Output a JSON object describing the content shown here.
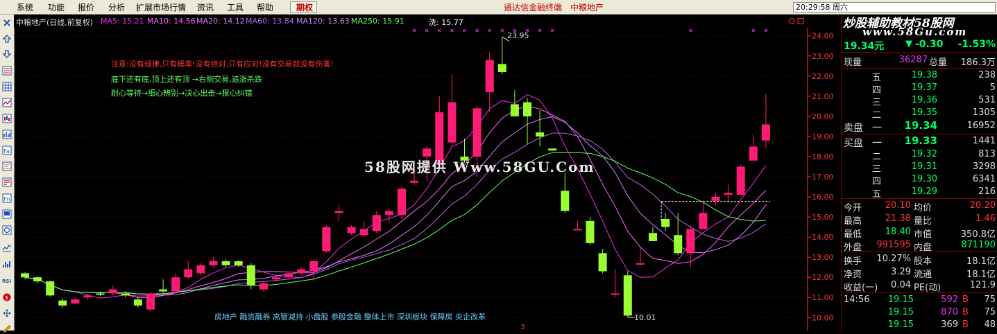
{
  "menu": {
    "items": [
      "系统",
      "功能",
      "报价",
      "分析",
      "扩展市场行情",
      "资讯",
      "工具",
      "帮助"
    ],
    "qiquan": "期权",
    "terminal": "通达信金融终端",
    "stock": "中粮地产",
    "clock": "20:29:58 周六"
  },
  "chart_header": {
    "title": "中粮地产(日线,前复权)",
    "ma5": "MA5: 15.21",
    "ma10": "MA10: 14.56",
    "ma20": "MA20: 14.12",
    "ma60": "MA60: 13.84",
    "ma120": "MA120: 13.63",
    "ma250": "MA250: 15.91",
    "xi": "洗: 15.77"
  },
  "notes": {
    "line1": "注意:没有规律,只有概率!没有绝对,只有应对!没有交易就没有伤害!",
    "line2": "底下还有底,顶上还有顶 →右侧交易,追涨杀跌",
    "line3": "耐心等待→细心辨别→决心出击→狠心纠错",
    "tags": "房地产 融资融券 高管减持 小盘股 参股金融 整体上市 深圳板块 保障房 央企改革",
    "marker": "3"
  },
  "watermark": {
    "center": "58股网提供  Www.58GU.Com",
    "top1": "炒股辅助教材58股网",
    "top2": "www.58Gu.com"
  },
  "chart_data": {
    "type": "candlestick",
    "y_ticks": [
      "24.00",
      "23.00",
      "22.00",
      "21.00",
      "20.00",
      "19.00",
      "18.00",
      "17.00",
      "16.00",
      "15.00",
      "14.00",
      "13.00",
      "12.00",
      "11.00",
      "10.00"
    ],
    "ylim": [
      9.7,
      24.3
    ],
    "high_label": "23.95",
    "low_label": "10.01",
    "colors": {
      "up": "#ff1a75",
      "down": "#99ff33",
      "ma": [
        "#e633e6",
        "#ff66ff",
        "#d580ff",
        "#b366e6",
        "#66ff66"
      ],
      "grid": "#800000",
      "axis": "#ff3333"
    },
    "candles": [
      [
        12.2,
        12.0,
        12.25,
        11.9
      ],
      [
        12.0,
        11.8,
        12.05,
        11.7
      ],
      [
        11.8,
        11.1,
        11.85,
        11.05
      ],
      [
        10.85,
        10.6,
        10.95,
        10.5
      ],
      [
        10.7,
        10.9,
        11.0,
        10.65
      ],
      [
        11.0,
        11.1,
        11.2,
        10.9
      ],
      [
        11.2,
        11.15,
        11.3,
        11.05
      ],
      [
        11.2,
        11.4,
        11.6,
        11.1
      ],
      [
        11.2,
        11.1,
        11.3,
        11.0
      ],
      [
        10.9,
        10.6,
        11.0,
        10.5
      ],
      [
        10.4,
        11.2,
        11.3,
        10.3
      ],
      [
        11.4,
        11.3,
        11.9,
        11.2
      ],
      [
        11.3,
        12.0,
        12.2,
        11.2
      ],
      [
        12.0,
        12.4,
        12.8,
        11.9
      ],
      [
        12.2,
        12.6,
        12.7,
        12.1
      ],
      [
        12.6,
        12.8,
        13.0,
        12.5
      ],
      [
        12.8,
        12.6,
        12.9,
        12.5
      ],
      [
        12.8,
        12.6,
        12.85,
        12.5
      ],
      [
        12.6,
        11.6,
        12.7,
        11.4
      ],
      [
        11.4,
        11.7,
        11.8,
        11.3
      ],
      [
        11.9,
        12.0,
        12.05,
        11.8
      ],
      [
        12.0,
        12.2,
        12.3,
        11.9
      ],
      [
        12.2,
        12.4,
        12.5,
        12.1
      ],
      [
        12.3,
        12.8,
        12.9,
        11.8
      ],
      [
        13.3,
        14.5,
        14.6,
        13.2
      ],
      [
        15.2,
        15.3,
        15.6,
        14.8
      ],
      [
        14.2,
        14.5,
        14.6,
        14.1
      ],
      [
        14.1,
        14.4,
        14.8,
        14.0
      ],
      [
        14.3,
        15.1,
        15.3,
        14.2
      ],
      [
        15.1,
        15.3,
        15.4,
        14.7
      ],
      [
        15.1,
        16.4,
        16.5,
        14.9
      ],
      [
        16.7,
        16.8,
        17.5,
        16.6
      ],
      [
        18.0,
        18.4,
        18.5,
        16.8
      ],
      [
        17.7,
        20.2,
        21.0,
        17.7
      ],
      [
        18.7,
        20.7,
        22.1,
        18.5
      ],
      [
        18.0,
        17.8,
        18.9,
        17.7
      ],
      [
        18.0,
        20.4,
        20.5,
        17.0
      ],
      [
        21.2,
        22.8,
        23.2,
        20.2
      ],
      [
        22.6,
        22.2,
        23.95,
        22.1
      ],
      [
        20.6,
        20.0,
        21.3,
        20.1
      ],
      [
        20.7,
        20.0,
        20.9,
        18.6
      ],
      [
        19.2,
        19.0,
        20.3,
        18.5
      ],
      [
        18.4,
        18.3,
        18.4,
        18.3
      ],
      [
        16.3,
        15.3,
        17.2,
        15.2
      ],
      [
        14.4,
        14.4,
        14.8,
        14.4
      ],
      [
        14.8,
        13.7,
        15.0,
        13.6
      ],
      [
        13.2,
        12.3,
        13.4,
        12.2
      ],
      [
        11.2,
        11.2,
        12.4,
        11.0
      ],
      [
        12.1,
        10.1,
        12.3,
        10.01
      ],
      [
        12.7,
        12.7,
        13.5,
        12.6
      ],
      [
        14.2,
        13.8,
        14.5,
        13.8
      ],
      [
        14.9,
        14.5,
        15.2,
        14.3
      ],
      [
        14.1,
        13.2,
        15.2,
        13.1
      ],
      [
        13.2,
        14.4,
        14.6,
        12.5
      ],
      [
        14.4,
        15.2,
        15.8,
        14.4
      ],
      [
        15.8,
        16.0,
        16.2,
        15.6
      ],
      [
        16.1,
        16.2,
        16.6,
        15.8
      ],
      [
        16.1,
        17.5,
        17.6,
        16.2
      ],
      [
        17.8,
        18.5,
        19.1,
        18.2
      ],
      [
        18.8,
        19.6,
        21.1,
        18.4
      ]
    ],
    "resistance": 15.77
  },
  "quote": {
    "price": "19.34元",
    "arrow": "▼",
    "change": "-0.30",
    "pct": "-1.53%",
    "xianliang_label": "现量",
    "xianliang": "36287",
    "zongliang_label": "总量",
    "zongliang": "186.3万",
    "sell": [
      {
        "label": "五",
        "price": "19.38",
        "vol": "238"
      },
      {
        "label": "四",
        "price": "19.37",
        "vol": "5"
      },
      {
        "label": "三",
        "price": "19.36",
        "vol": "531"
      },
      {
        "label": "二",
        "price": "19.35",
        "vol": "1305"
      }
    ],
    "sell1": {
      "side": "卖盘",
      "label": "一",
      "price": "19.34",
      "vol": "16952"
    },
    "buy1": {
      "side": "买盘",
      "label": "一",
      "price": "19.33",
      "vol": "1441"
    },
    "buy": [
      {
        "label": "二",
        "price": "19.32",
        "vol": "813"
      },
      {
        "label": "三",
        "price": "19.31",
        "vol": "3298"
      },
      {
        "label": "四",
        "price": "19.30",
        "vol": "6341"
      },
      {
        "label": "五",
        "price": "19.29",
        "vol": "216"
      }
    ],
    "stats": [
      {
        "l1": "今开",
        "v1": "20.10",
        "l2": "均价",
        "v2": "20.20"
      },
      {
        "l1": "最高",
        "v1": "21.38",
        "l2": "量比",
        "v2": "1.46"
      },
      {
        "l1": "最低",
        "v1": "18.40",
        "l2": "市值",
        "v2": "350.8亿"
      },
      {
        "l1": "外盘",
        "v1": "991595",
        "l2": "内盘",
        "v2": "871190"
      }
    ],
    "fin": [
      {
        "l1": "换手",
        "v1": "10.27%",
        "l2": "股本",
        "v2": "18.1亿"
      },
      {
        "l1": "净资",
        "v1": "3.29",
        "l2": "流通",
        "v2": "18.1亿"
      },
      {
        "l1": "收益(一)",
        "v1": "0.04",
        "l2": "PE(动)",
        "v2": "121.9"
      }
    ],
    "ticks": [
      {
        "time": "14:56",
        "price": "19.15",
        "vol": "592",
        "bs": "B",
        "n": "75"
      },
      {
        "time": "",
        "price": "19.15",
        "vol": "870",
        "bs": "B",
        "n": "75"
      },
      {
        "time": "",
        "price": "19.15",
        "vol": "369",
        "bs": "B",
        "n": "48"
      }
    ]
  }
}
